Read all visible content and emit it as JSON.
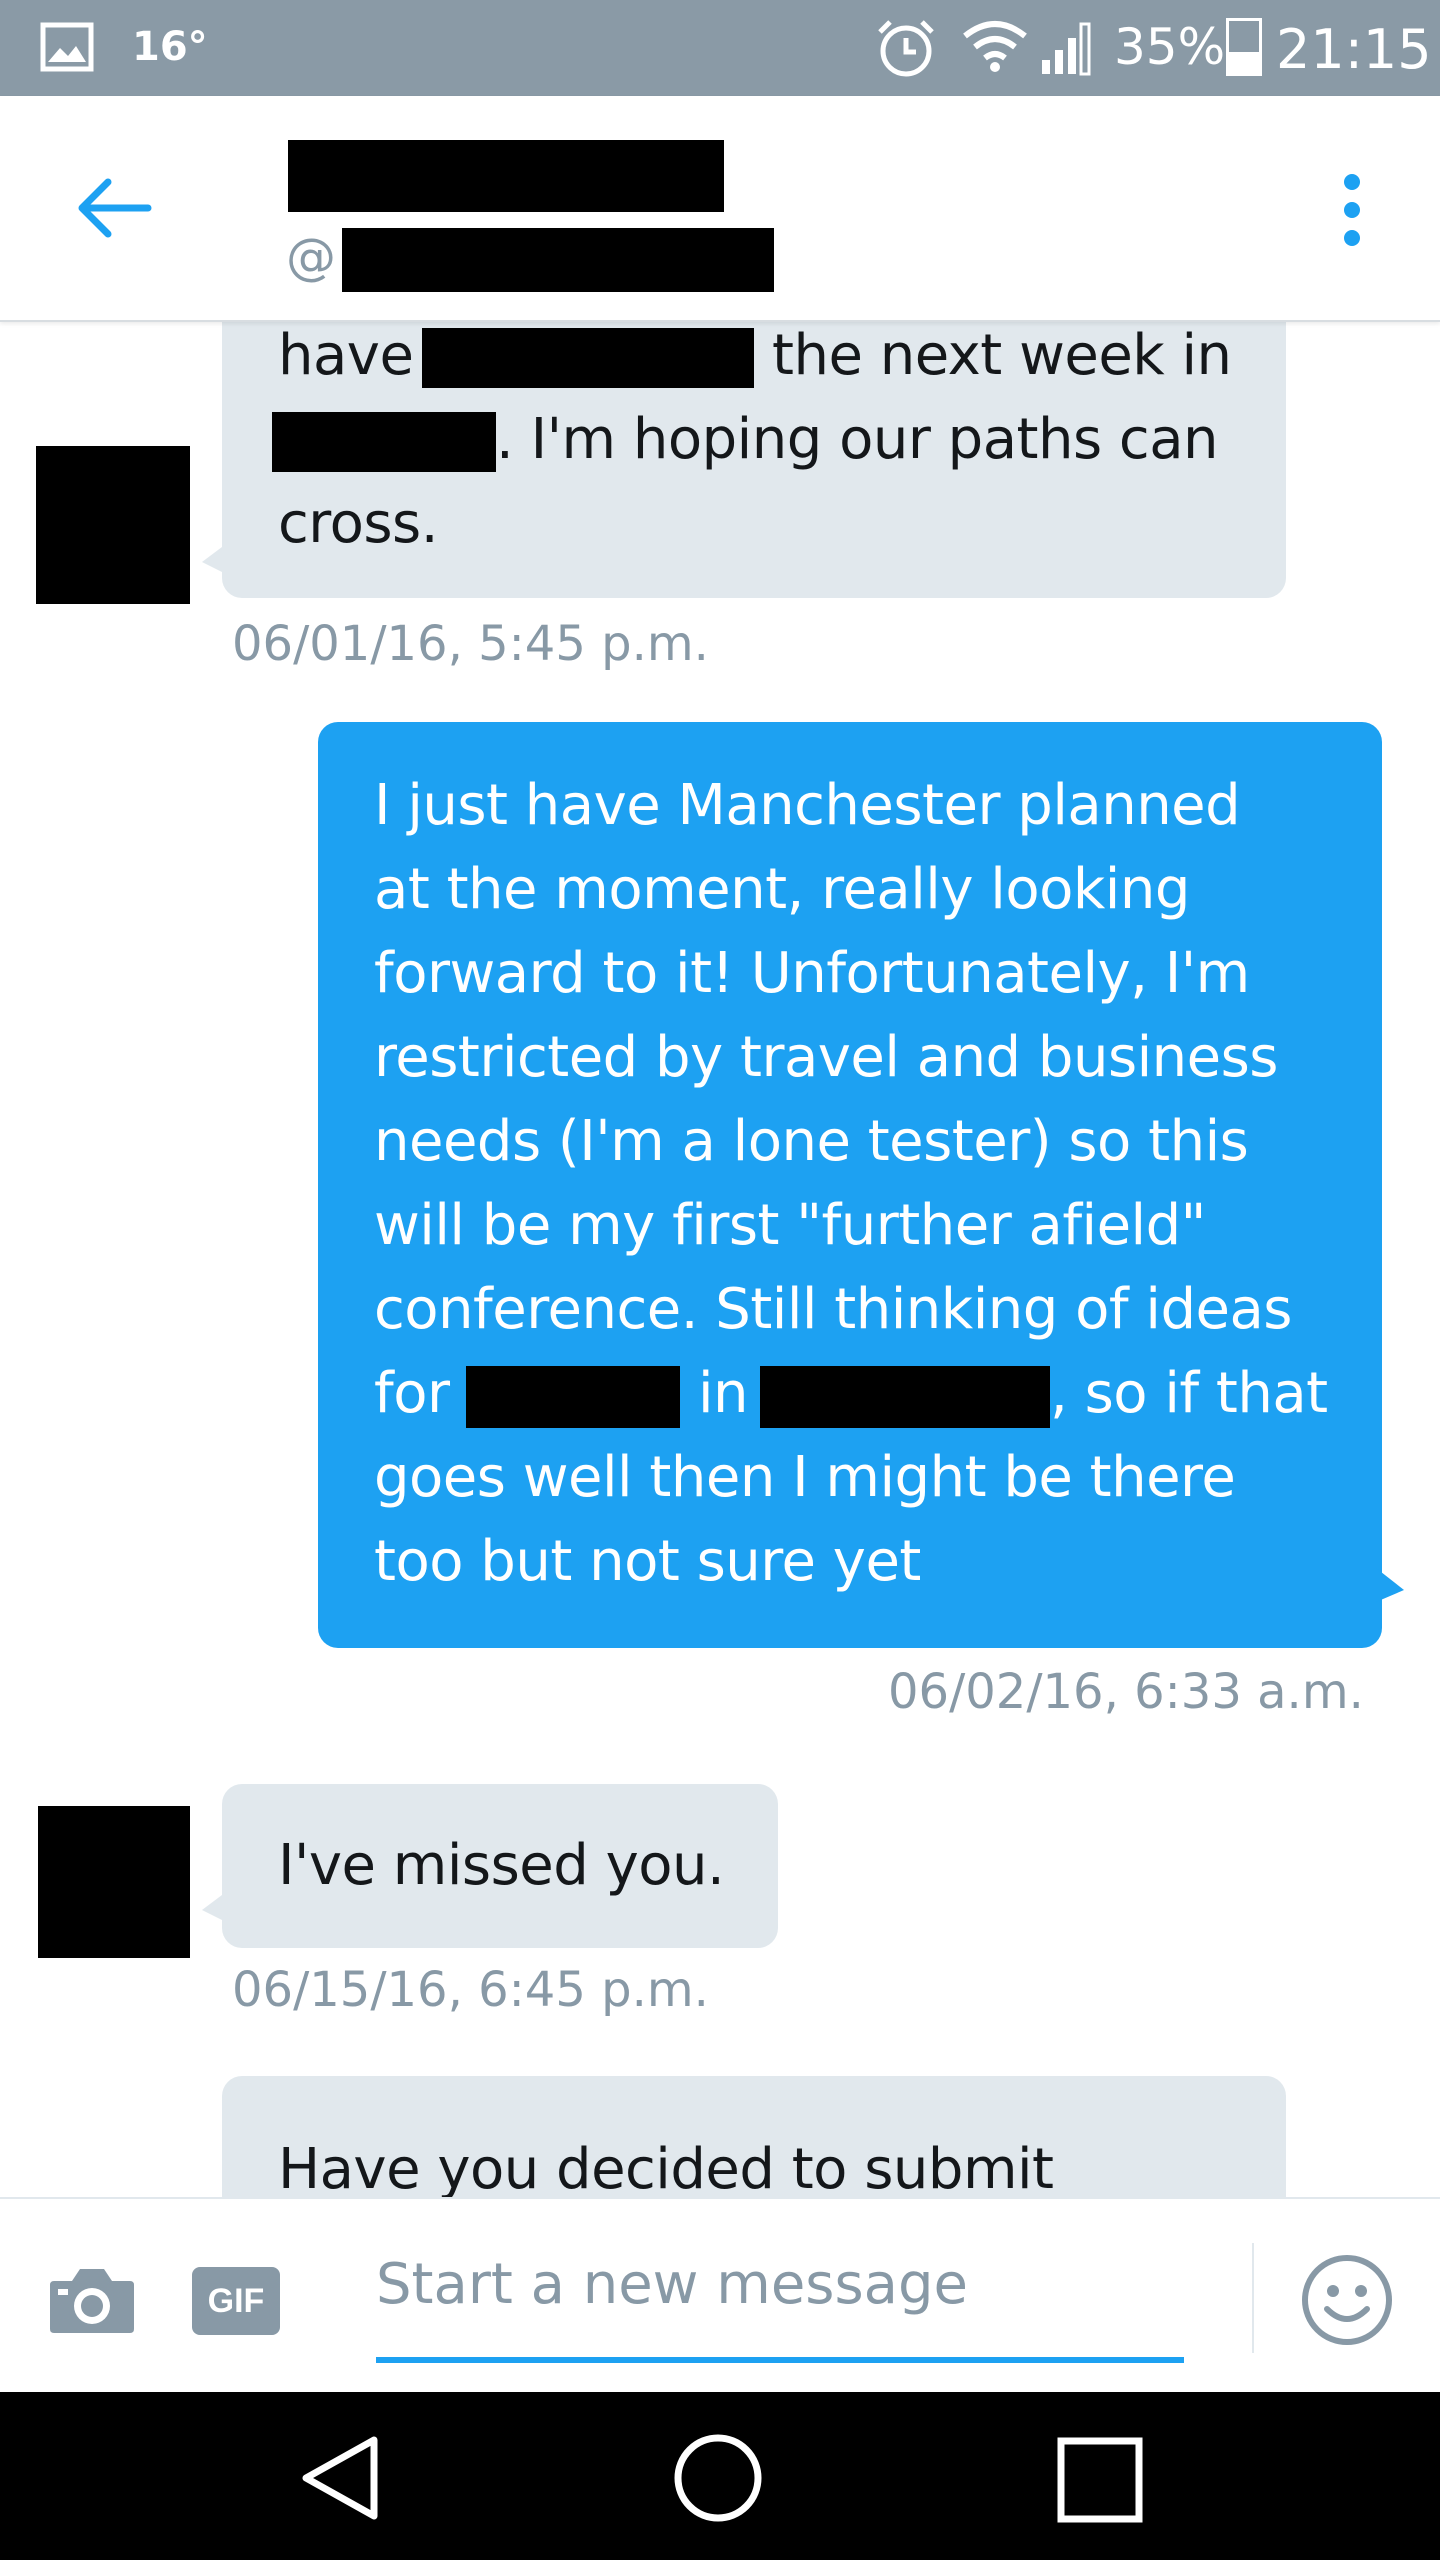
{
  "status_bar": {
    "temperature": "16°",
    "battery_percent": "35%",
    "time": "21:15",
    "battery_level": 0.35,
    "icons": [
      "image-icon",
      "alarm-icon",
      "wifi-icon",
      "signal-icon",
      "battery-icon"
    ]
  },
  "header": {
    "handle_prefix": "@",
    "icons": [
      "back-arrow-icon",
      "more-vertical-icon"
    ]
  },
  "messages": {
    "m1": {
      "line1_a": "have",
      "line1_b": "the next week in",
      "line2": ". I'm hoping our paths can",
      "line3": "cross.",
      "time": "06/01/16, 5:45 p.m."
    },
    "m2": {
      "lines": [
        "I just have Manchester planned",
        "at the moment, really looking",
        "forward to it! Unfortunately, I'm",
        "restricted by travel and business",
        "needs (I'm a lone tester) so this",
        "will be my first \"further afield\"",
        "conference. Still thinking of ideas"
      ],
      "line8_a": "for",
      "line8_b": "in",
      "line8_c": ", so if that",
      "line9": "goes well then I might be there",
      "line10": "too but not sure yet",
      "time": "06/02/16, 6:33 a.m."
    },
    "m3": {
      "text": "I've missed you.",
      "time": "06/15/16, 6:45 p.m."
    },
    "m4": {
      "text": "Have you decided to submit"
    }
  },
  "composer": {
    "gif_label": "GIF",
    "placeholder": "Start a new message",
    "icons": [
      "camera-icon",
      "gif-icon",
      "emoji-icon"
    ]
  },
  "nav_bar": {
    "icons": [
      "back-triangle-icon",
      "home-circle-icon",
      "recents-square-icon"
    ]
  },
  "colors": {
    "accent": "#1da1f2",
    "incoming_bubble": "#e1e8ed",
    "timestamp": "#8899a6",
    "status_bar": "#8a9aa6"
  }
}
